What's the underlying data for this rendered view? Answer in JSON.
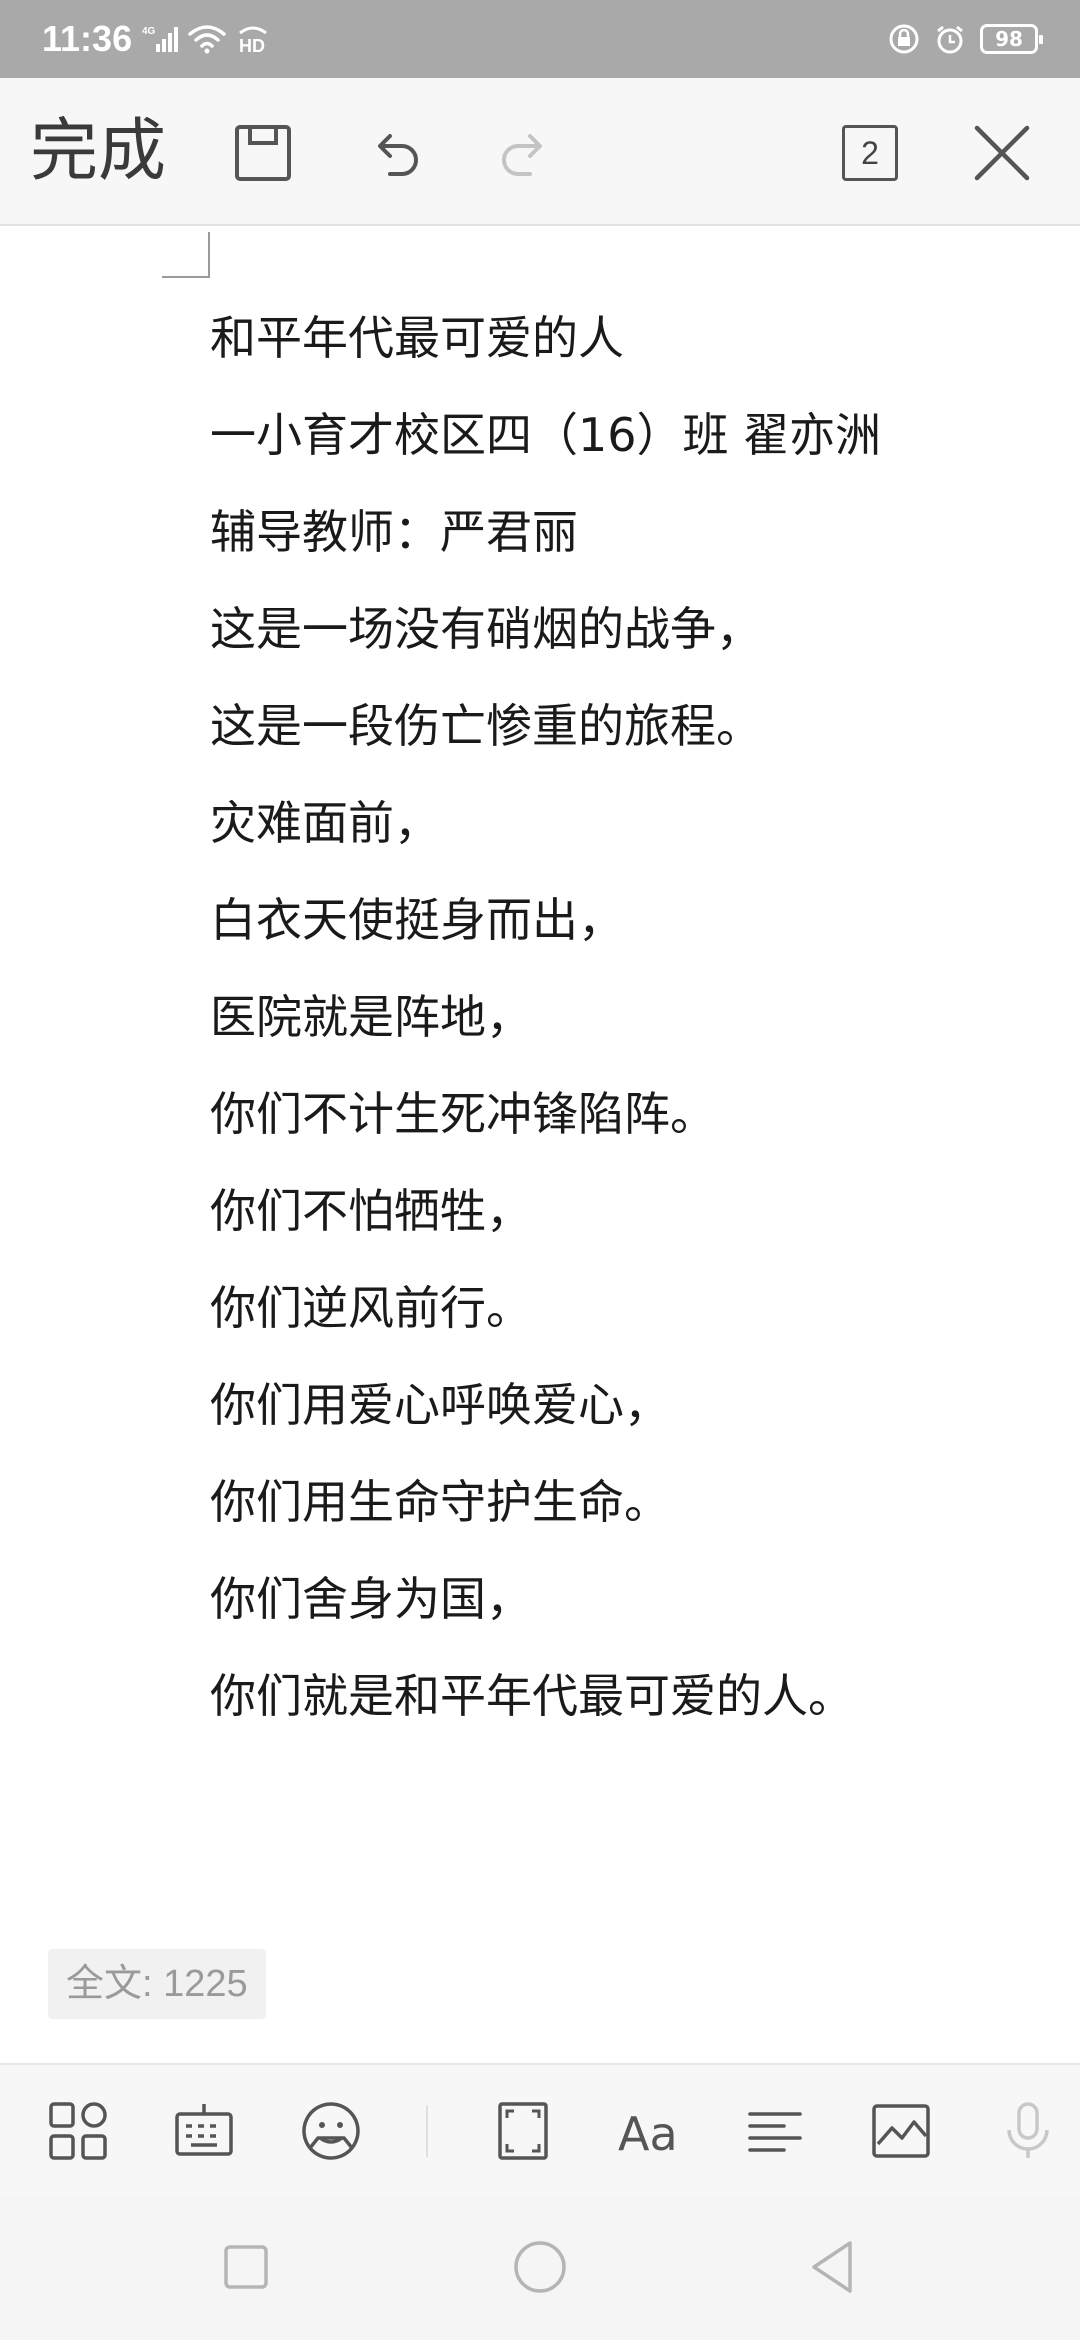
{
  "status_bar": {
    "time": "11:36",
    "network_badge": "4G",
    "hd_badge": "HD",
    "battery": "98"
  },
  "toolbar": {
    "done_label": "完成",
    "page_count": "2",
    "icons": [
      "save-icon",
      "undo-icon",
      "redo-icon",
      "page-count-icon",
      "close-icon"
    ]
  },
  "document": {
    "lines": [
      "和平年代最可爱的人",
      "一小育才校区四（16）班  翟亦洲",
      "辅导教师：严君丽",
      "这是一场没有硝烟的战争，",
      "这是一段伤亡惨重的旅程。",
      "灾难面前，",
      "白衣天使挺身而出，",
      "医院就是阵地，",
      "你们不计生死冲锋陷阵。",
      "你们不怕牺牲，",
      "你们逆风前行。",
      "你们用爱心呼唤爱心，",
      "你们用生命守护生命。",
      "你们舍身为国，",
      "你们就是和平年代最可爱的人。"
    ],
    "word_count": "全文: 1225"
  },
  "edit_toolbar": {
    "icons": [
      "apps-icon",
      "keyboard-icon",
      "sticker-icon",
      "fullscreen-icon",
      "font-icon",
      "align-icon",
      "image-icon",
      "microphone-icon"
    ],
    "font_glyph": "Aa"
  },
  "nav_bar": {
    "icons": [
      "recents-icon",
      "home-icon",
      "back-icon"
    ]
  },
  "colors": {
    "status_bar_bg": "#a9a9a9",
    "toolbar_bg": "#f7f7f7",
    "text": "#1a1a1a",
    "icon": "#555555",
    "disabled_icon": "#c4c4c4"
  }
}
